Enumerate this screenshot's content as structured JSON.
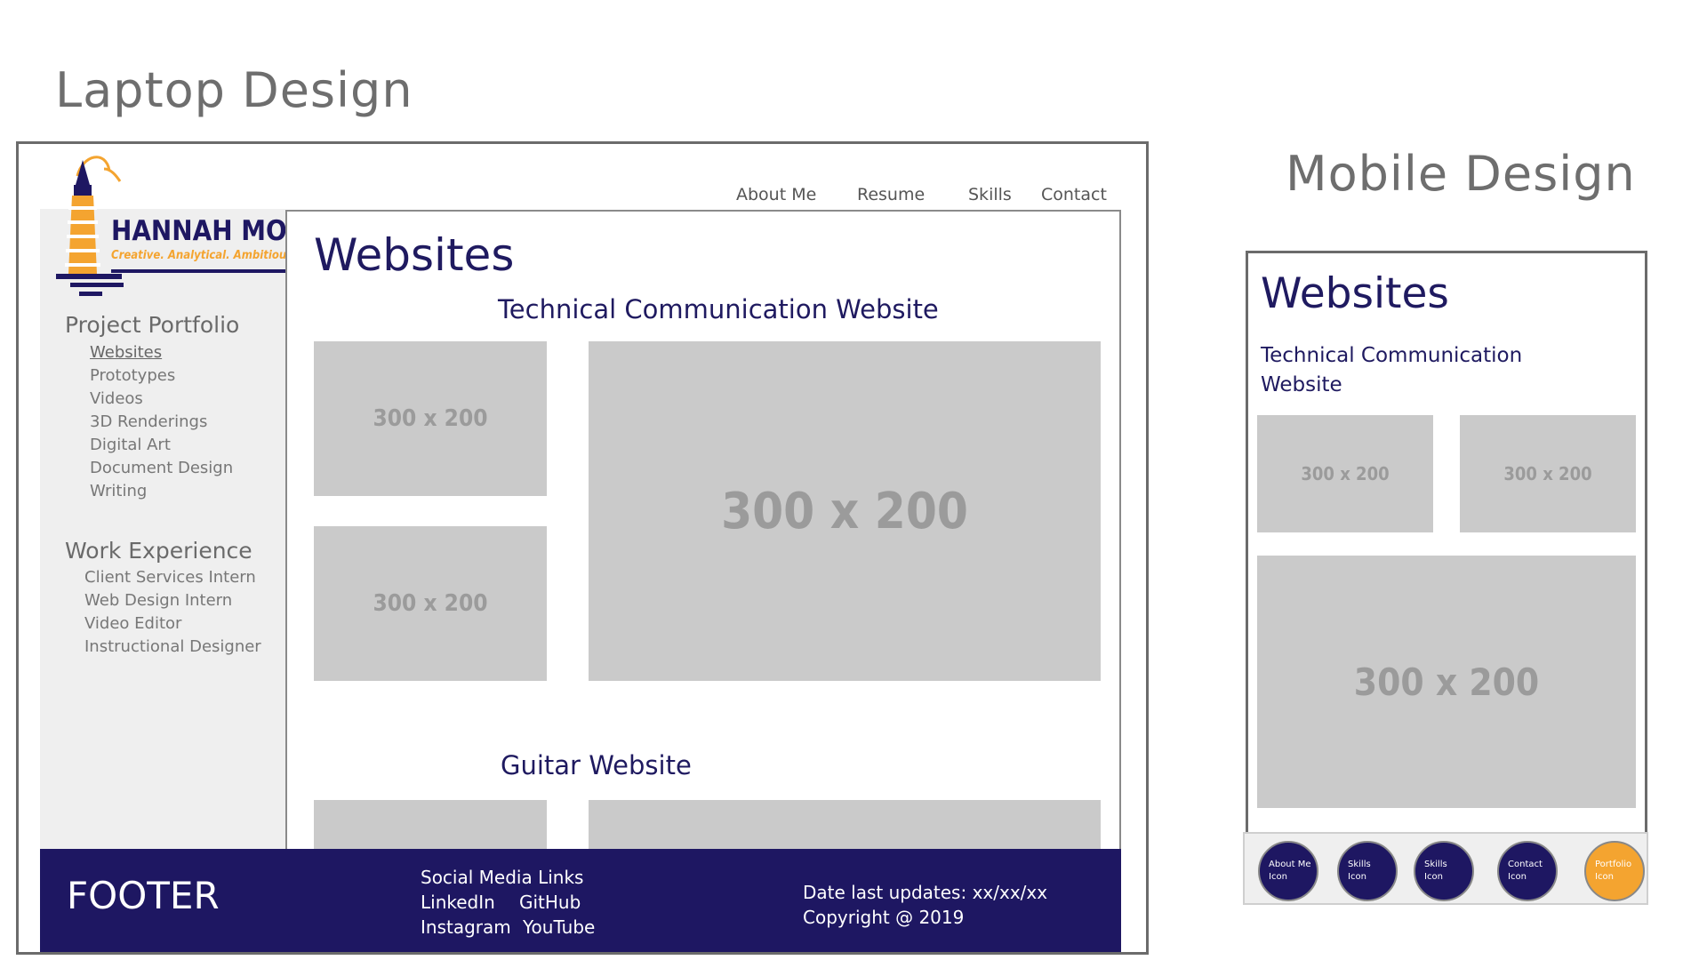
{
  "laptop_heading": "Laptop Design",
  "mobile_heading": "Mobile Design",
  "logo": {
    "name": "HANNAH MONK",
    "tagline": "Creative. Analytical. Ambitious.",
    "colors": {
      "navy": "#1e1762",
      "orange": "#f4a430"
    }
  },
  "top_nav": [
    "About Me",
    "Resume",
    "Skills",
    "Contact"
  ],
  "sidebar": {
    "portfolio_heading": "Project Portfolio",
    "portfolio_items": [
      "Websites",
      "Prototypes",
      "Videos",
      "3D Renderings",
      "Digital Art",
      "Document Design",
      "Writing"
    ],
    "experience_heading": "Work Experience",
    "experience_items": [
      "Client Services Intern",
      "Web Design Intern",
      "Video Editor",
      "Instructional Designer"
    ]
  },
  "main": {
    "title": "Websites",
    "section1": "Technical Communication Website",
    "section2": "Guitar Website",
    "placeholder_label": "300 x 200"
  },
  "footer": {
    "label": "FOOTER",
    "social_heading": "Social Media Links",
    "linkedin": "LinkedIn",
    "github": "GitHub",
    "instagram": "Instagram",
    "youtube": "YouTube",
    "date": "Date last updates: xx/xx/xx",
    "copyright": "Copyright @ 2019"
  },
  "mobile": {
    "title": "Websites",
    "section1_line1": "Technical Communication",
    "section1_line2": "Website",
    "placeholder_label": "300 x 200",
    "nav": [
      {
        "line1": "About Me",
        "line2": "Icon"
      },
      {
        "line1": "Skills",
        "line2": "Icon"
      },
      {
        "line1": "Skills",
        "line2": "Icon"
      },
      {
        "line1": "Contact",
        "line2": "Icon"
      },
      {
        "line1": "Portfolio",
        "line2": "Icon"
      }
    ]
  }
}
